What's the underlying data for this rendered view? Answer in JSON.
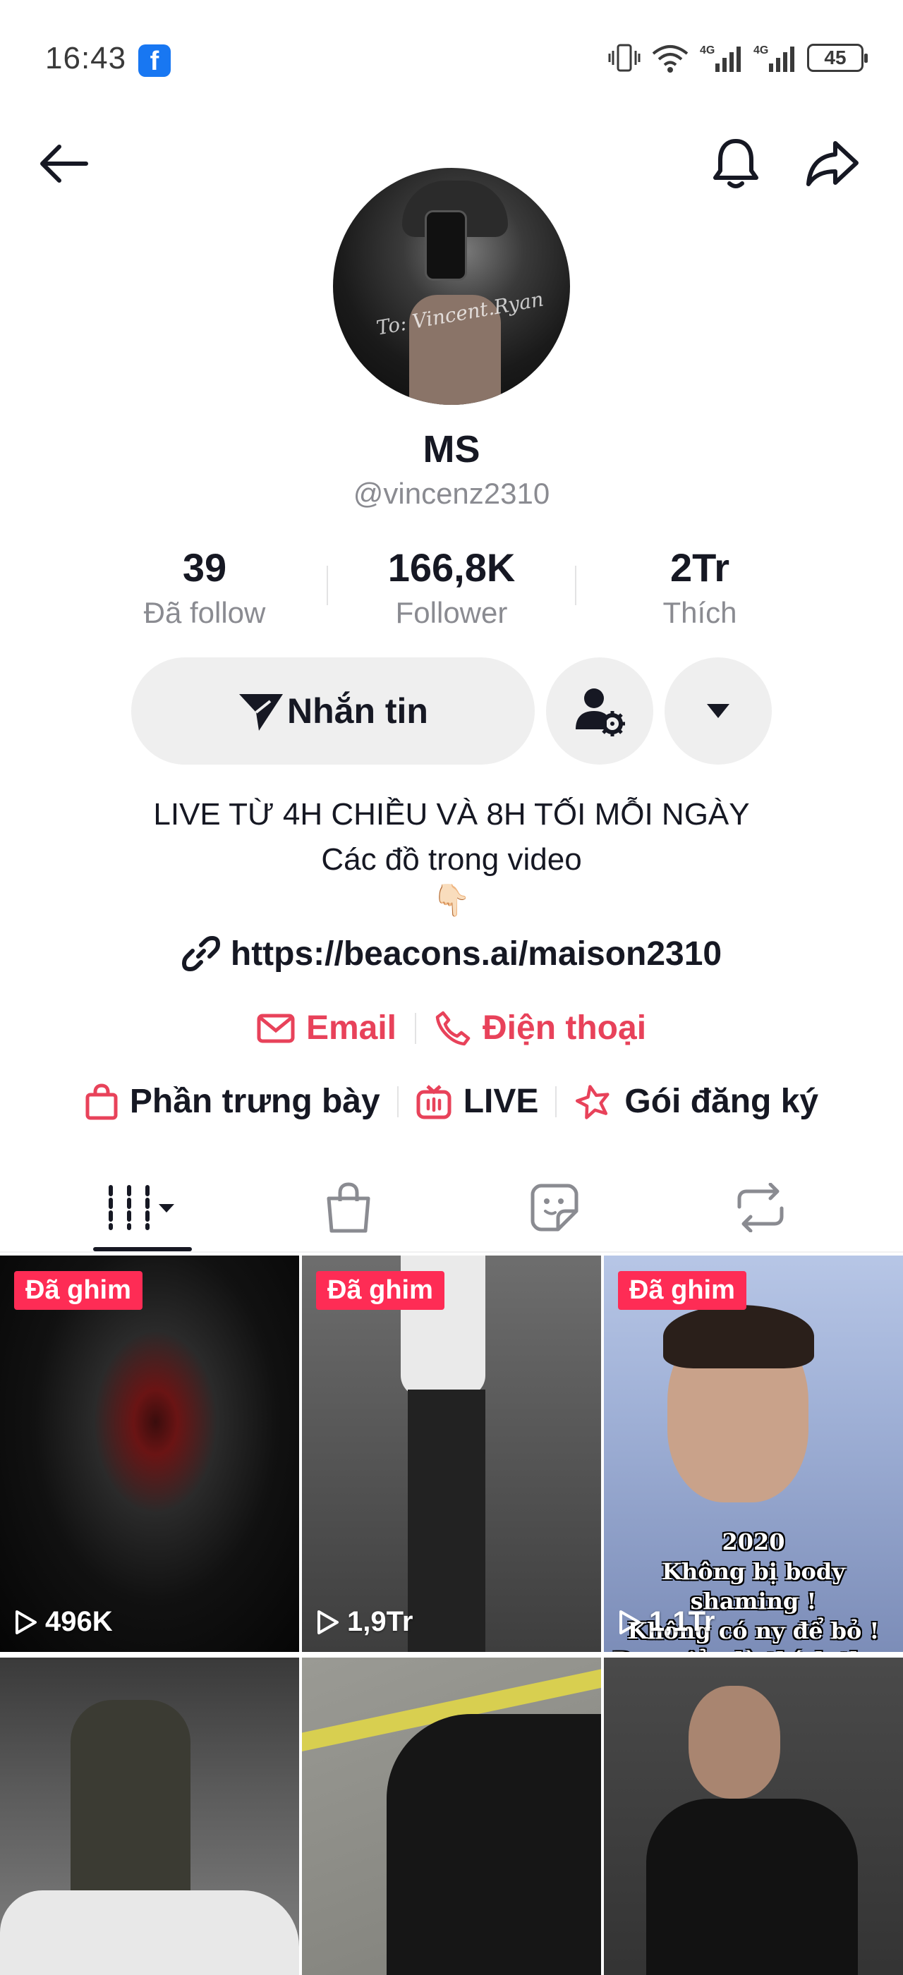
{
  "status_bar": {
    "time": "16:43",
    "battery": "45"
  },
  "profile": {
    "display_name": "MS",
    "username": "@vincenz2310",
    "avatar_signature": "To: Vincent.Ryan"
  },
  "stats": [
    {
      "value": "39",
      "label": "Đã follow"
    },
    {
      "value": "166,8K",
      "label": "Follower"
    },
    {
      "value": "2Tr",
      "label": "Thích"
    }
  ],
  "actions": {
    "message_label": "Nhắn tin"
  },
  "bio": {
    "line1": "LIVE TỪ 4H CHIỀU VÀ 8H TỐI MỖI NGÀY",
    "line2": "Các đồ trong video",
    "emoji": "👇🏻"
  },
  "link": "https://beacons.ai/maison2310",
  "contacts": {
    "email": "Email",
    "phone": "Điện thoại"
  },
  "features": {
    "showcase": "Phần trưng bày",
    "live": "LIVE",
    "subscription": "Gói đăng ký"
  },
  "videos": [
    {
      "pinned": "Đã ghim",
      "views": "496K"
    },
    {
      "pinned": "Đã ghim",
      "views": "1,9Tr"
    },
    {
      "pinned": "Đã ghim",
      "views": "1,1Tr",
      "caption": [
        "2020",
        "Không bị body shaming !",
        "Không có ny để bỏ !",
        "Đơn giản là thích thay"
      ]
    },
    {
      "pinned": "",
      "views": ""
    },
    {
      "pinned": "",
      "views": ""
    },
    {
      "pinned": "",
      "views": ""
    }
  ],
  "colors": {
    "accent": "#fe2c55",
    "contact": "#e8425a",
    "text": "#161823",
    "muted": "#8a8b91"
  }
}
